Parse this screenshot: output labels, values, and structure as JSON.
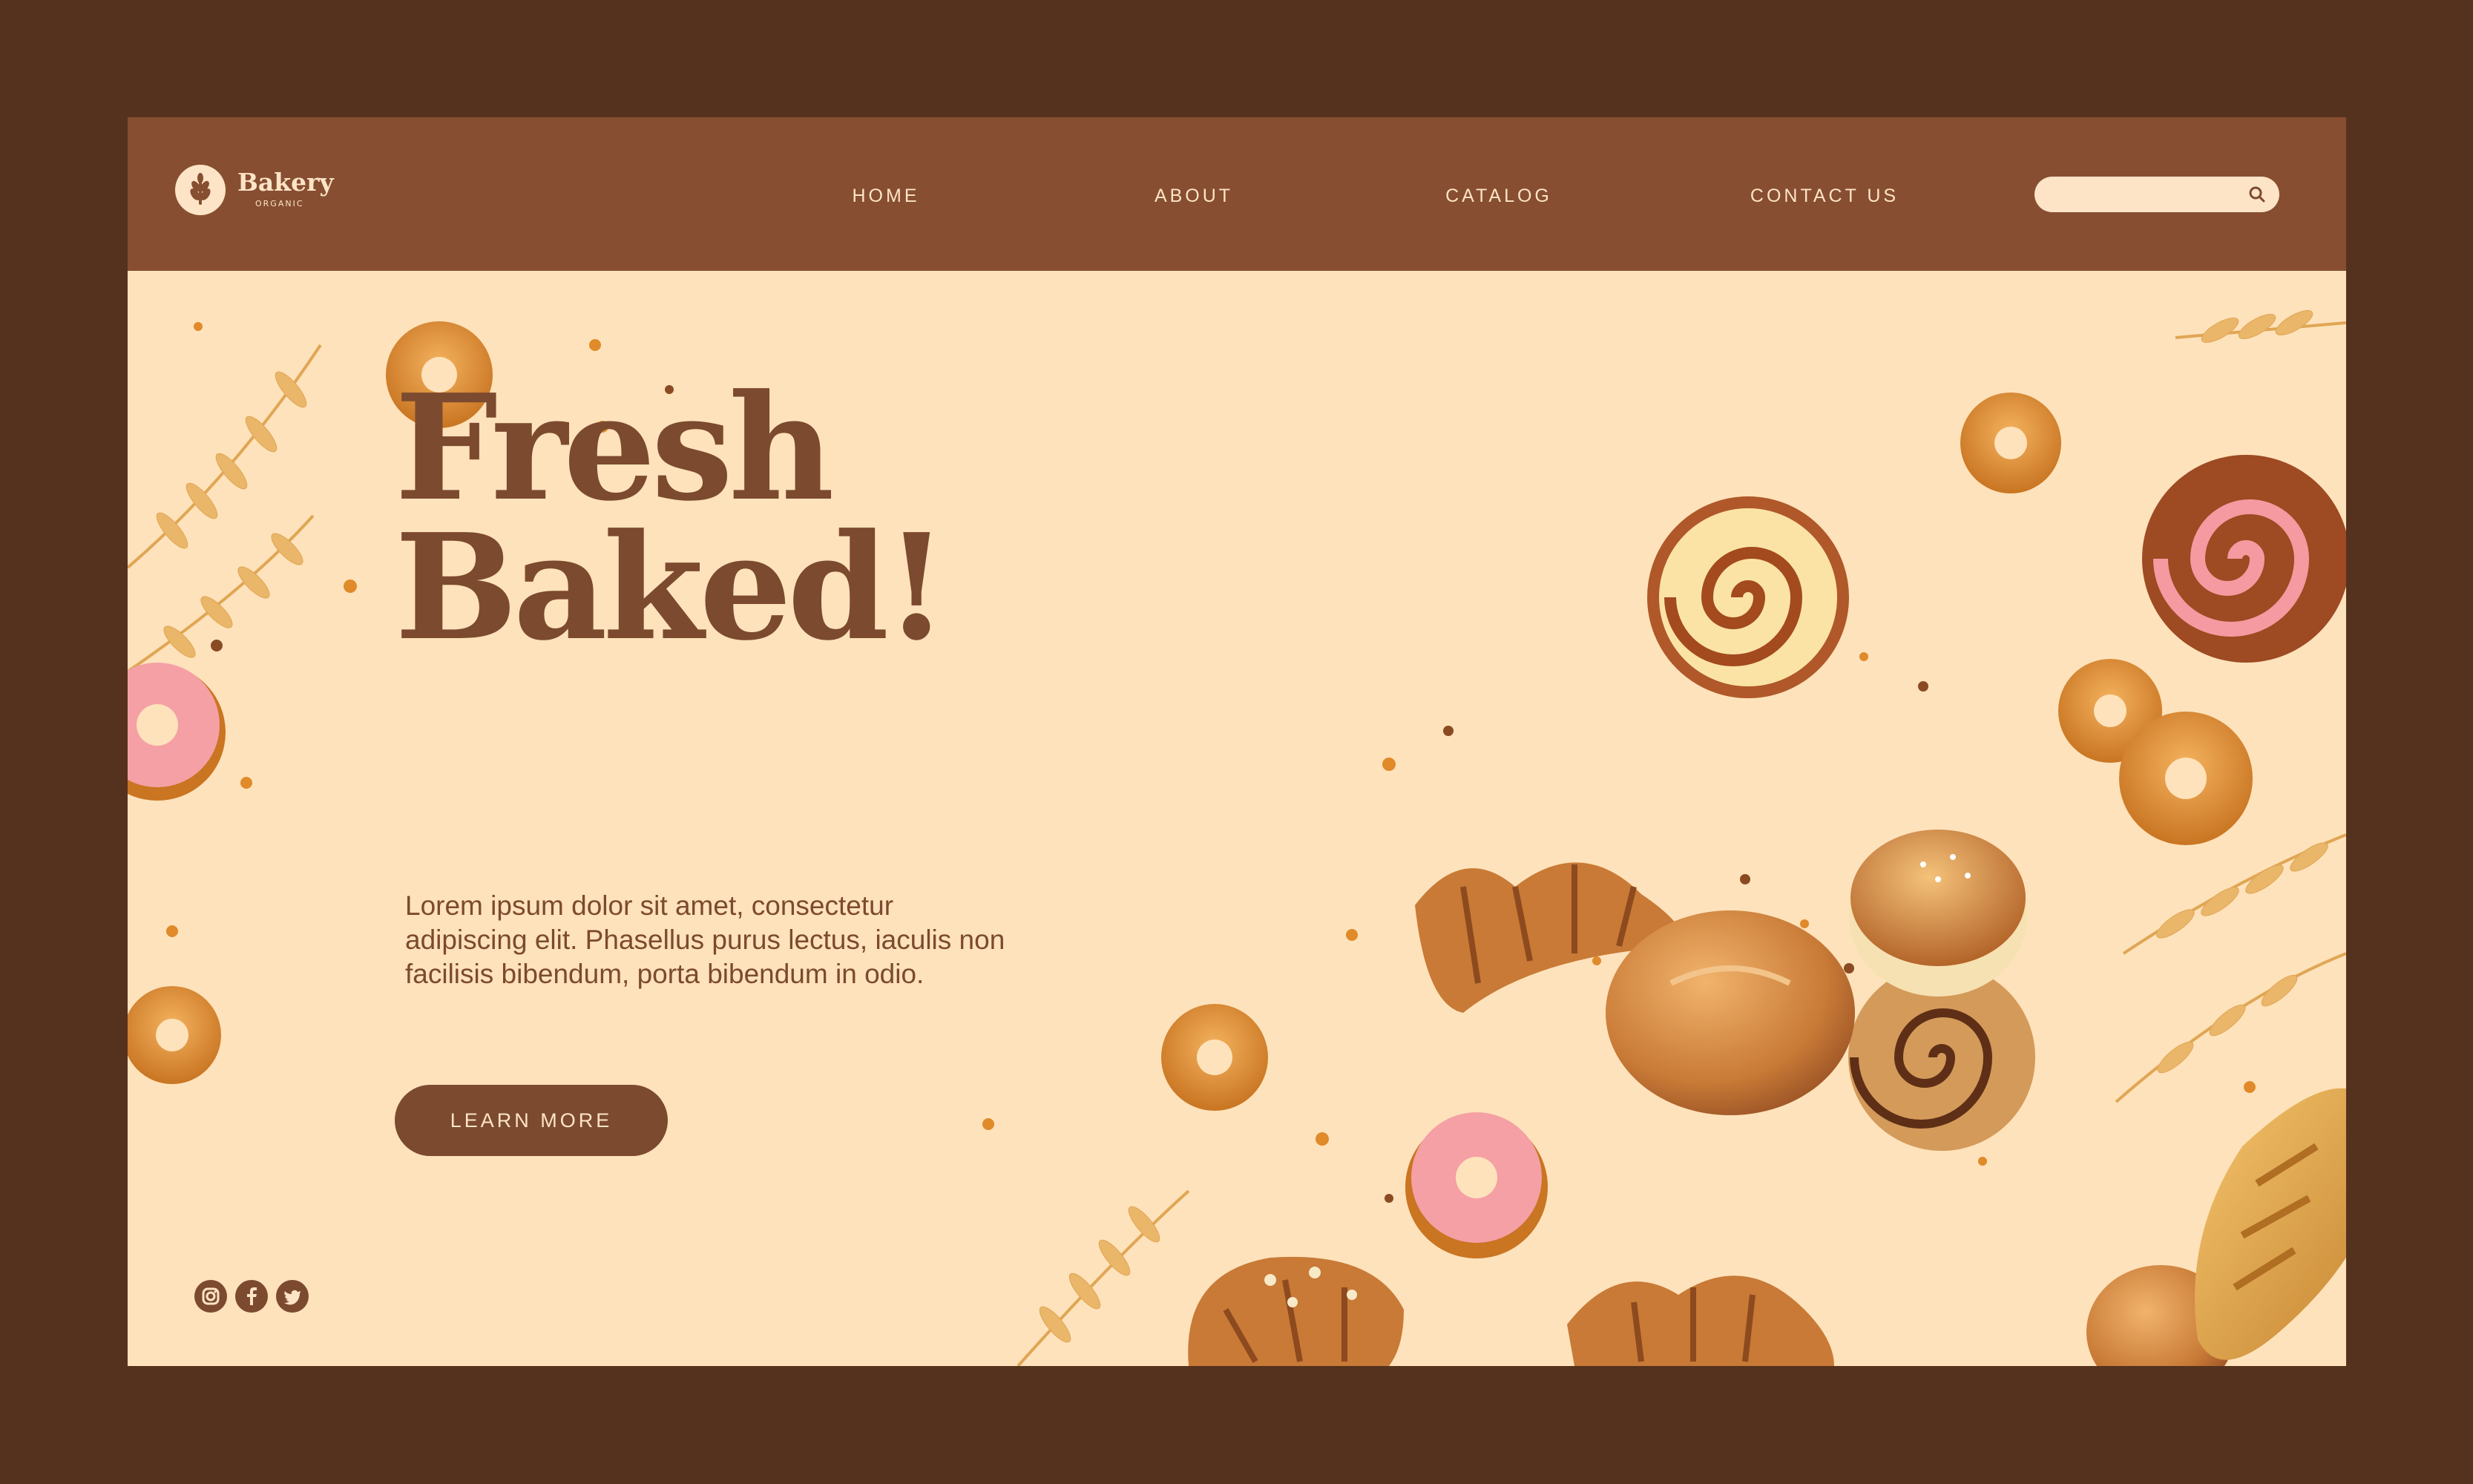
{
  "brand": {
    "name": "Bakery",
    "tagline": "ORGANIC"
  },
  "nav": {
    "items": [
      {
        "label": "HOME"
      },
      {
        "label": "ABOUT"
      },
      {
        "label": "CATALOG"
      },
      {
        "label": "CONTACT US"
      }
    ]
  },
  "search": {
    "placeholder": "",
    "value": "",
    "icon": "search-icon"
  },
  "hero": {
    "headline_line1": "Fresh",
    "headline_line2": "Baked!",
    "body": "Lorem ipsum dolor sit amet, consectetur adipiscing elit. Phasellus purus lectus, iaculis non facilisis bibendum, porta bibendum in odio.",
    "cta_label": "LEARN MORE"
  },
  "social": [
    {
      "icon": "instagram-icon"
    },
    {
      "icon": "facebook-icon"
    },
    {
      "icon": "twitter-icon"
    }
  ],
  "colors": {
    "page_border": "#55321d",
    "navbar": "#874e31",
    "hero_background": "#fee2bb",
    "text_brown": "#7c4a2f",
    "cream": "#fde4c6"
  }
}
